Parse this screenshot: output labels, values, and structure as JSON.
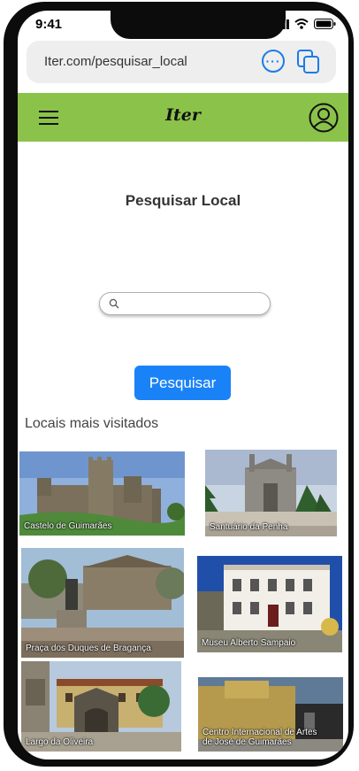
{
  "status_bar": {
    "time": "9:41"
  },
  "browser": {
    "url": "Iter.com/pesquisar_local"
  },
  "navbar": {
    "brand": "Iter",
    "color": "#8bc34a"
  },
  "page": {
    "title": "Pesquisar Local"
  },
  "search": {
    "placeholder": "",
    "button_label": "Pesquisar",
    "button_color": "#1a82f7"
  },
  "popular": {
    "title": "Locais mais visitados",
    "places": [
      {
        "name": "Castelo de Guimarães"
      },
      {
        "name": "Santuário da Penha"
      },
      {
        "name": "Praça dos Duques de Bragança"
      },
      {
        "name": "Museu Alberto Sampaio"
      },
      {
        "name": "Largo da Oliveira"
      },
      {
        "name": "Centro Internacional de Artes de José de Guimarães"
      }
    ]
  }
}
